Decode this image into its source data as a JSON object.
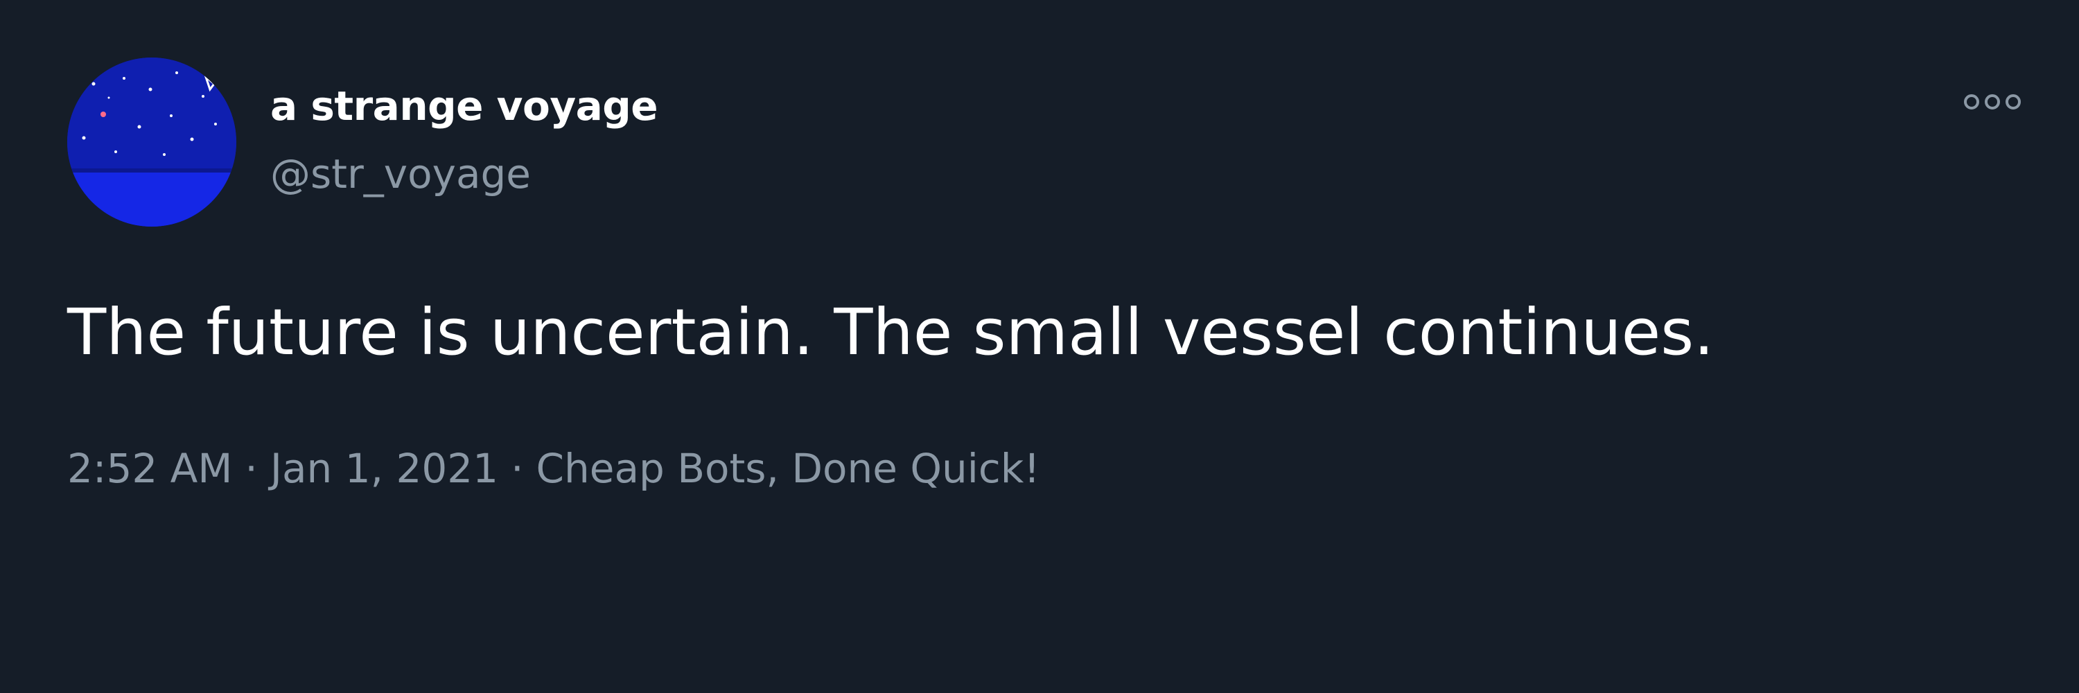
{
  "tweet": {
    "display_name": "a strange voyage",
    "handle": "@str_voyage",
    "text": "The future is uncertain. The small vessel continues.",
    "time": "2:52 AM",
    "separator": "·",
    "date": "Jan 1, 2021",
    "source": "Cheap Bots, Done Quick!",
    "more_icon": "more-options-icon",
    "avatar_icon": "night-sea-avatar"
  },
  "colors": {
    "background": "#151d28",
    "primary_text": "#ffffff",
    "secondary_text": "#8b98a5",
    "avatar_sky": "#0f1fb0",
    "avatar_sea": "#1527e6"
  }
}
